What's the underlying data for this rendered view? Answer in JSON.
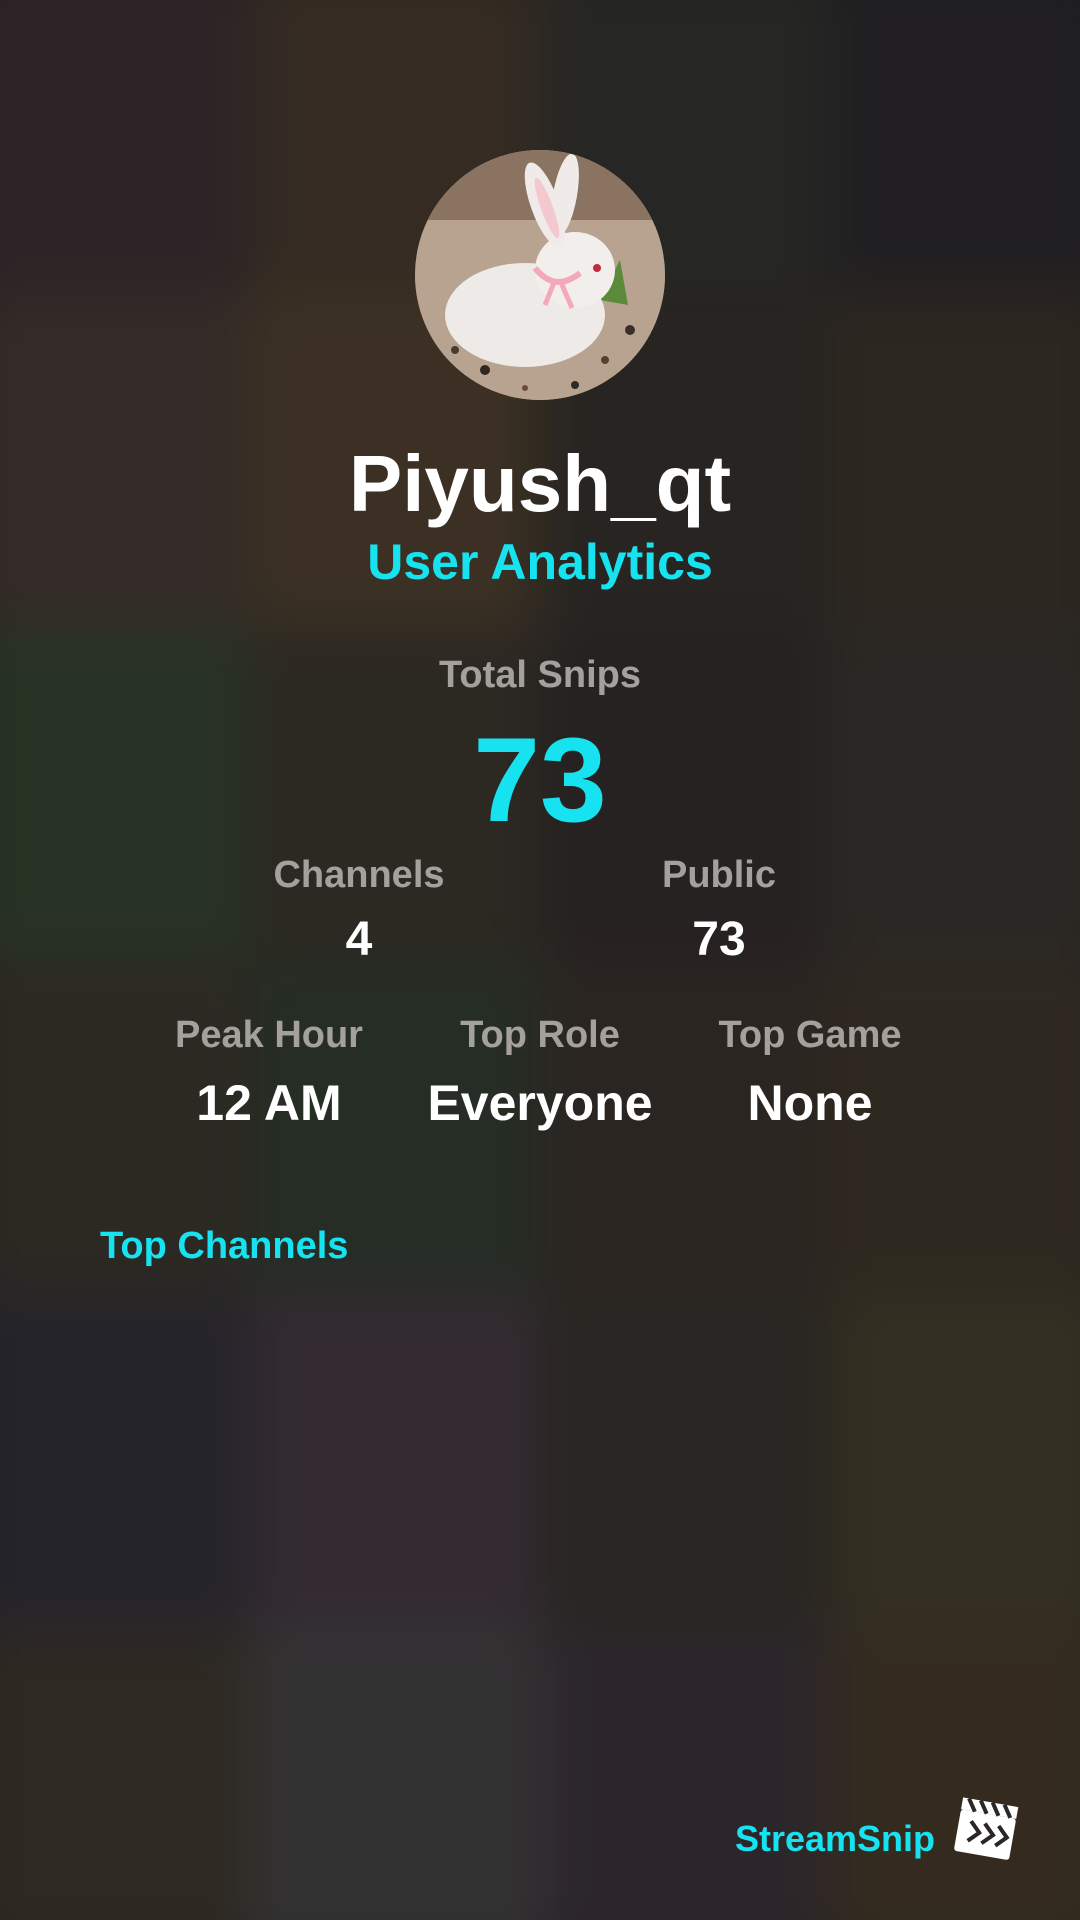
{
  "profile": {
    "username": "Piyush_qt",
    "subtitle": "User Analytics"
  },
  "stats": {
    "total_snips_label": "Total Snips",
    "total_snips_value": "73",
    "channels_label": "Channels",
    "channels_value": "4",
    "public_label": "Public",
    "public_value": "73",
    "peak_hour_label": "Peak Hour",
    "peak_hour_value": "12 AM",
    "top_role_label": "Top Role",
    "top_role_value": "Everyone",
    "top_game_label": "Top Game",
    "top_game_value": "None"
  },
  "sections": {
    "top_channels_title": "Top Channels"
  },
  "brand": {
    "name": "StreamSnip",
    "logo_icon": "clapperboard-icon"
  },
  "colors": {
    "accent": "#17e3f0",
    "label": "#a3a09e",
    "value": "#ffffff"
  }
}
